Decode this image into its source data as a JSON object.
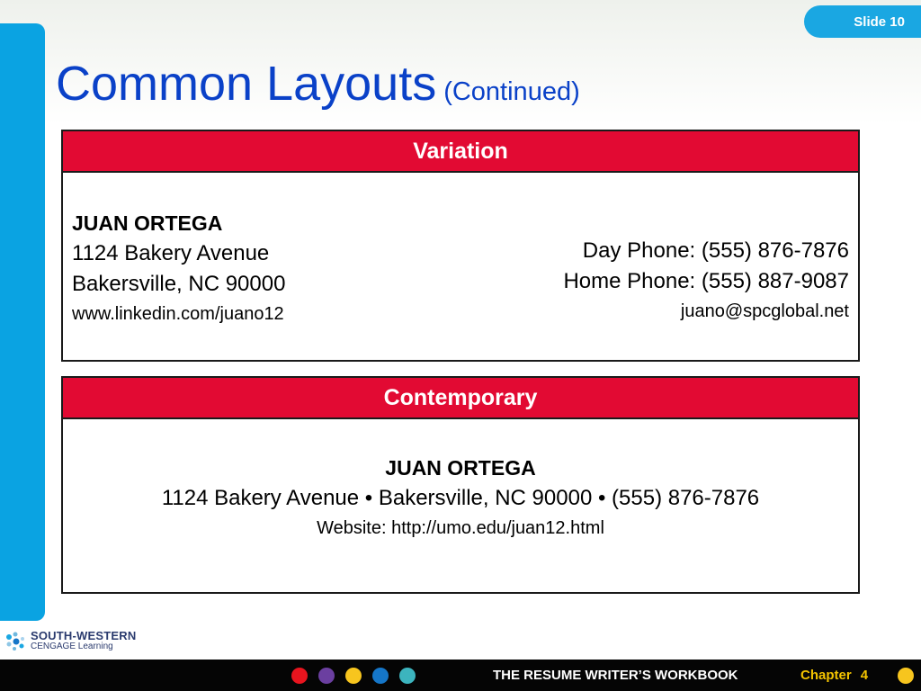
{
  "slide_label": "Slide 10",
  "title": {
    "main": "Common Layouts",
    "sub": "(Continued)"
  },
  "variation": {
    "header": "Variation",
    "name": "JUAN ORTEGA",
    "address_line1": "1124 Bakery Avenue",
    "address_line2": "Bakersville, NC 90000",
    "linkedin": "www.linkedin.com/juano12",
    "day_phone": "Day Phone: (555) 876-7876",
    "home_phone": "Home Phone: (555) 887-9087",
    "email": "juano@spcglobal.net"
  },
  "contemporary": {
    "header": "Contemporary",
    "name": "JUAN ORTEGA",
    "contact_line": "1124 Bakery Avenue • Bakersville, NC 90000 • (555) 876-7876",
    "website": "Website: http://umo.edu/juan12.html"
  },
  "logo": {
    "line1": "SOUTH-WESTERN",
    "line2": "CENGAGE Learning"
  },
  "footer": {
    "book_title": "THE RESUME WRITER’S WORKBOOK",
    "chapter_label": "Chapter",
    "chapter_number": "4"
  },
  "colors": {
    "accent_blue": "#0aa3e2",
    "title_blue": "#0a41c8",
    "header_red": "#e20a33",
    "chapter_yellow": "#f4c400",
    "nav_dots": [
      "#e8141e",
      "#6b3fa0",
      "#f7c51e",
      "#1576c8",
      "#3cb4be"
    ]
  }
}
